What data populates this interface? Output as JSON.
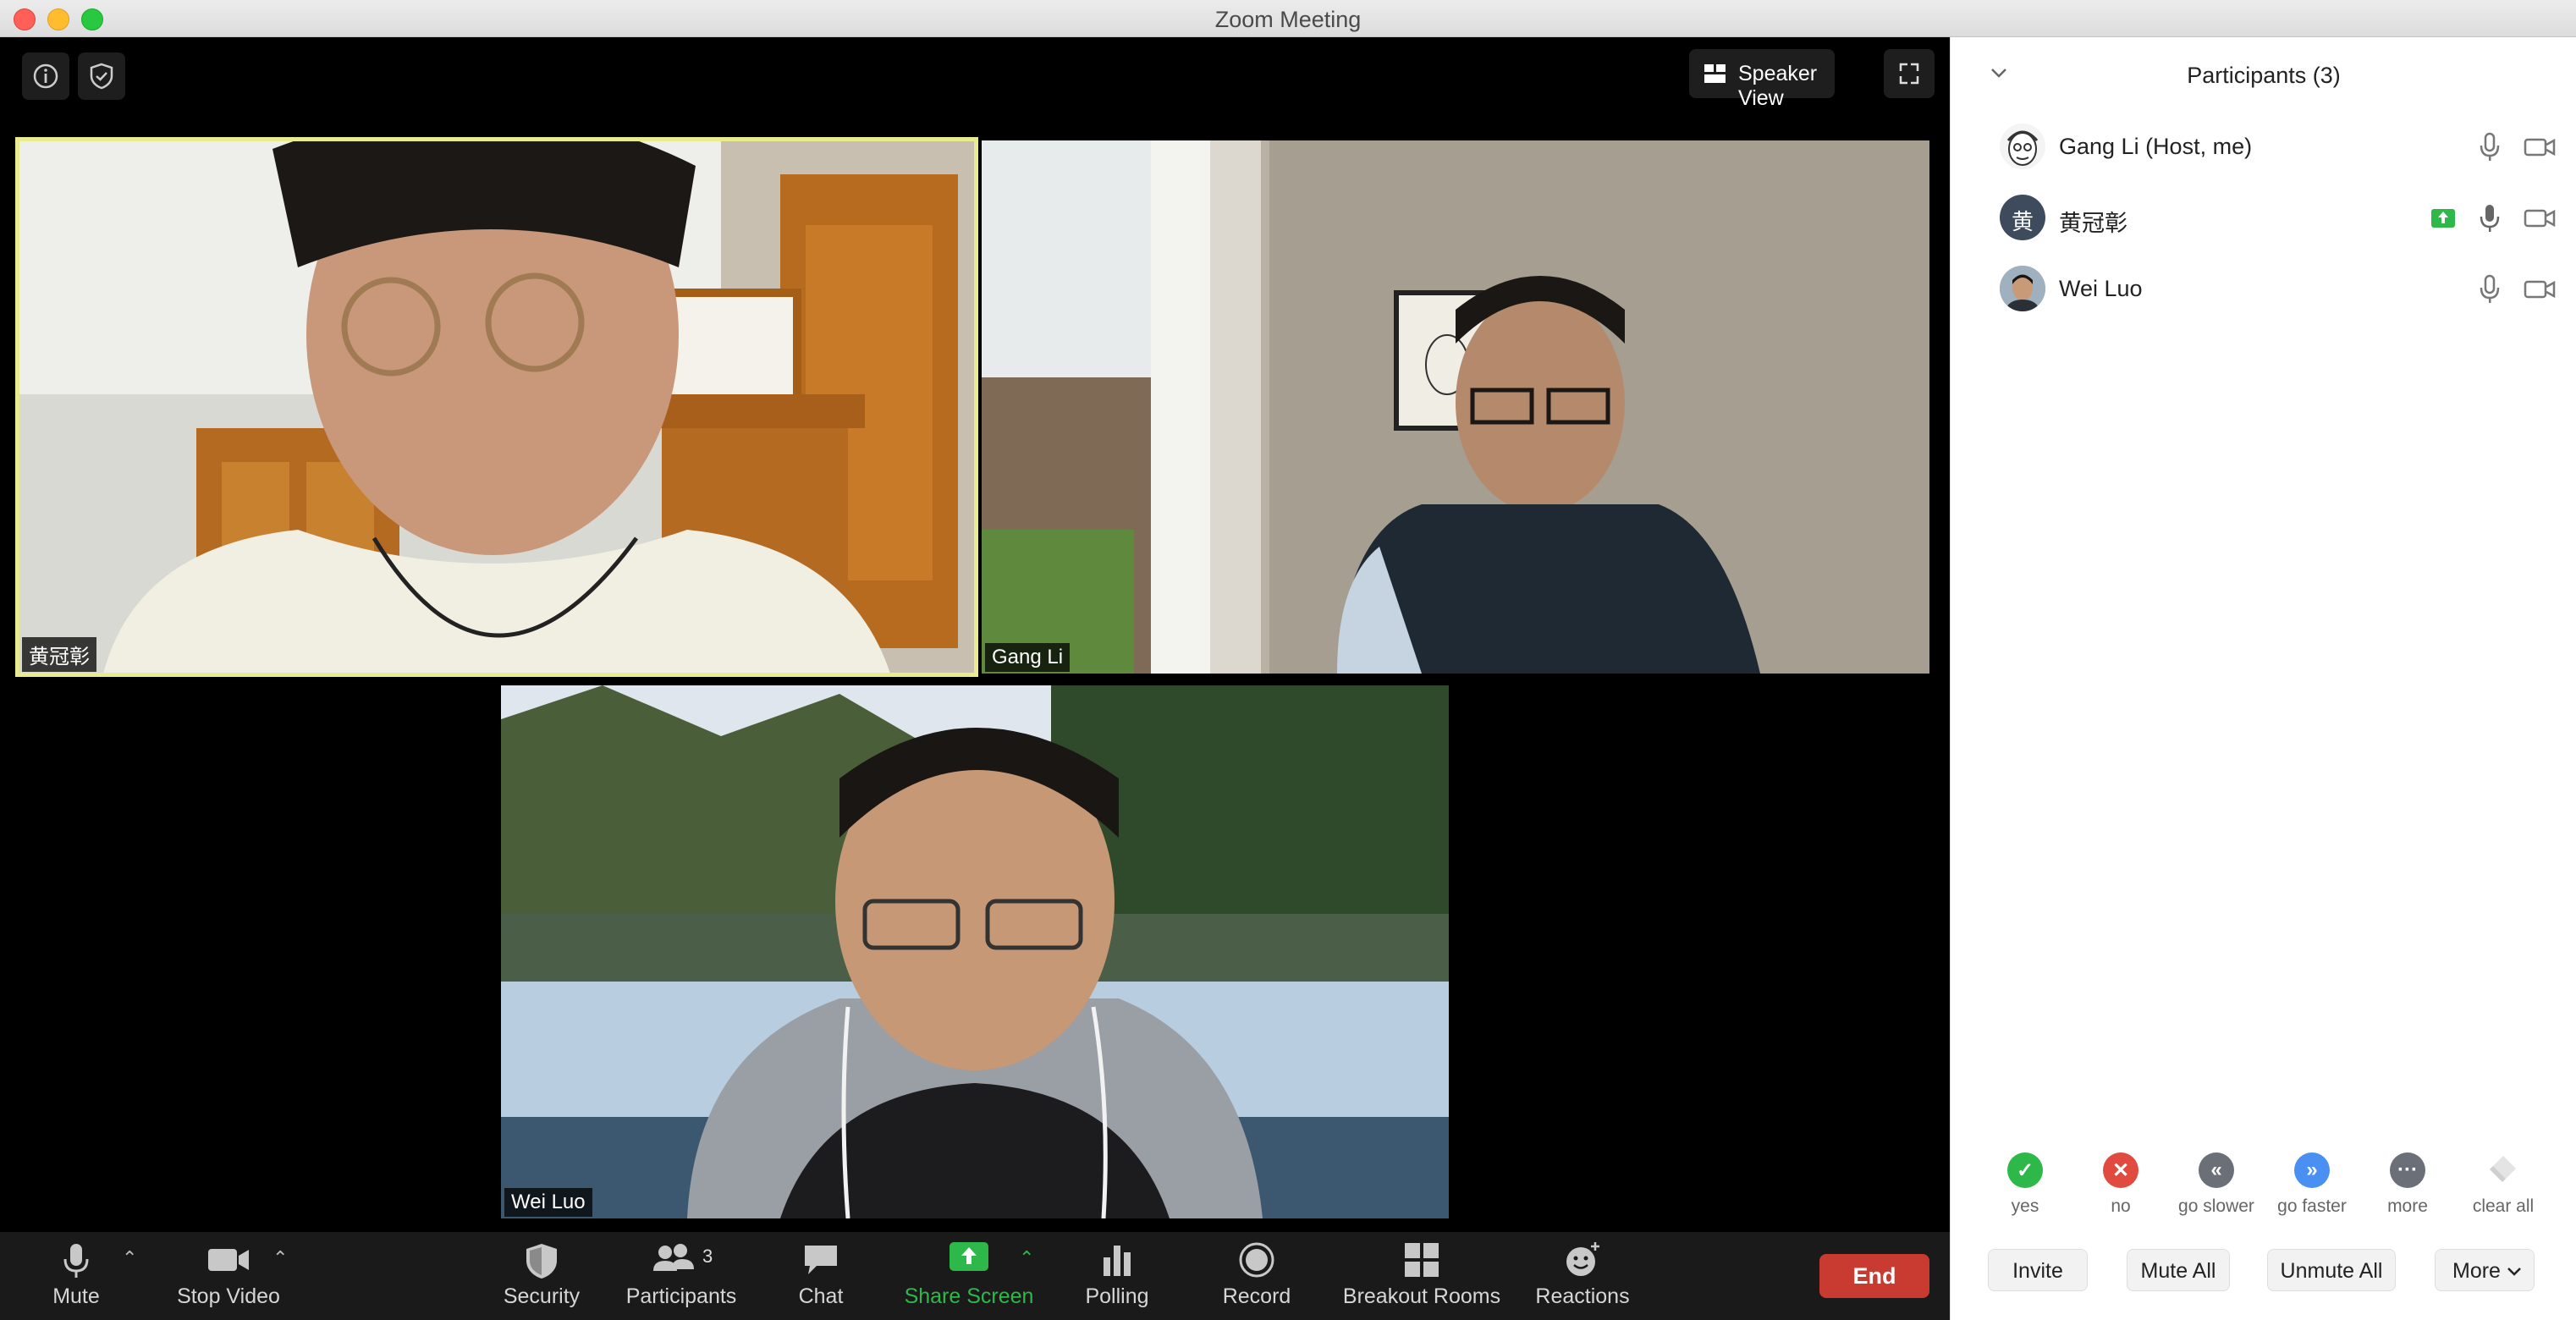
{
  "window": {
    "title": "Zoom Meeting"
  },
  "top_bar": {
    "view_label": "Speaker View"
  },
  "videos": [
    {
      "name": "黄冠彰"
    },
    {
      "name": "Gang Li"
    },
    {
      "name": "Wei Luo"
    }
  ],
  "toolbar": {
    "mute": "Mute",
    "stop_video": "Stop Video",
    "security": "Security",
    "participants": "Participants",
    "participants_count": "3",
    "chat": "Chat",
    "share_screen": "Share Screen",
    "polling": "Polling",
    "record": "Record",
    "breakout_rooms": "Breakout Rooms",
    "reactions": "Reactions",
    "end": "End"
  },
  "panel": {
    "title": "Participants (3)",
    "participants": [
      {
        "name": "Gang Li (Host, me)"
      },
      {
        "name": "黄冠彰",
        "avatar_char": "黄"
      },
      {
        "name": "Wei Luo"
      }
    ],
    "feedback": [
      "yes",
      "no",
      "go slower",
      "go faster",
      "more",
      "clear all"
    ],
    "buttons": {
      "invite": "Invite",
      "mute_all": "Mute All",
      "unmute_all": "Unmute All",
      "more": "More"
    }
  },
  "colors": {
    "accent_green": "#2fb84a",
    "end_red": "#c93a30",
    "active_speaker": "#e8ec8f",
    "blue": "#4a90f2"
  }
}
